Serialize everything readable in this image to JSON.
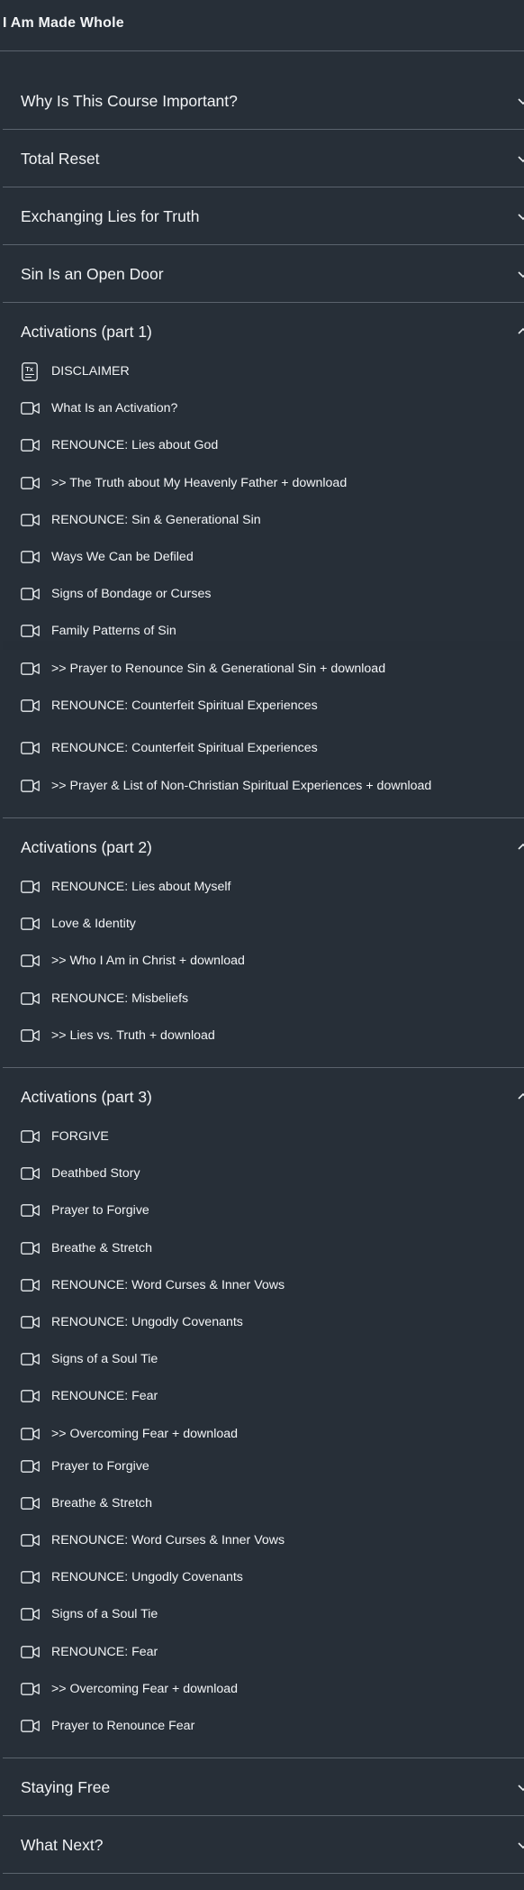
{
  "course": {
    "title": "I Am Made Whole"
  },
  "sections": [
    {
      "title": "Why Is This Course Important?",
      "expanded": false,
      "lessons": []
    },
    {
      "title": "Total Reset",
      "expanded": false,
      "lessons": []
    },
    {
      "title": "Exchanging Lies for Truth",
      "expanded": false,
      "lessons": []
    },
    {
      "title": "Sin Is an Open Door",
      "expanded": false,
      "lessons": []
    },
    {
      "title": "Activations (part 1)",
      "expanded": true,
      "lessons": [
        {
          "label": "DISCLAIMER",
          "icon": "document-text-icon"
        },
        {
          "label": "What Is an Activation?",
          "icon": "video-camera-icon"
        },
        {
          "label": "RENOUNCE: Lies about God",
          "icon": "video-camera-icon"
        },
        {
          "label": ">> The Truth about My Heavenly Father + download",
          "icon": "video-camera-icon"
        },
        {
          "label": "RENOUNCE: Sin & Generational Sin",
          "icon": "video-camera-icon"
        },
        {
          "label": "Ways We Can be Defiled",
          "icon": "video-camera-icon"
        },
        {
          "label": "Signs of Bondage or Curses",
          "icon": "video-camera-icon"
        },
        {
          "label": "Family Patterns of Sin",
          "icon": "video-camera-icon"
        },
        {
          "label": ">> Prayer to Renounce Sin & Generational Sin + download",
          "icon": "video-camera-icon"
        },
        {
          "label": "RENOUNCE: Counterfeit Spiritual Experiences",
          "icon": "video-camera-icon"
        },
        {
          "label": "RENOUNCE: Counterfeit Spiritual Experiences",
          "icon": "video-camera-icon"
        },
        {
          "label": ">> Prayer & List of Non-Christian Spiritual Experiences + download",
          "icon": "video-camera-icon"
        }
      ]
    },
    {
      "title": "Activations (part 2)",
      "expanded": true,
      "lessons": [
        {
          "label": "RENOUNCE: Lies about Myself",
          "icon": "video-camera-icon"
        },
        {
          "label": "Love & Identity",
          "icon": "video-camera-icon"
        },
        {
          "label": ">> Who I Am in Christ + download",
          "icon": "video-camera-icon"
        },
        {
          "label": "RENOUNCE: Misbeliefs",
          "icon": "video-camera-icon"
        },
        {
          "label": ">> Lies vs. Truth + download",
          "icon": "video-camera-icon"
        }
      ]
    },
    {
      "title": "Activations (part 3)",
      "expanded": true,
      "lessons": [
        {
          "label": "FORGIVE",
          "icon": "video-camera-icon"
        },
        {
          "label": "Deathbed Story",
          "icon": "video-camera-icon"
        },
        {
          "label": "Prayer to Forgive",
          "icon": "video-camera-icon"
        },
        {
          "label": "Breathe & Stretch",
          "icon": "video-camera-icon"
        },
        {
          "label": "RENOUNCE: Word Curses & Inner Vows",
          "icon": "video-camera-icon"
        },
        {
          "label": "RENOUNCE: Ungodly Covenants",
          "icon": "video-camera-icon"
        },
        {
          "label": "Signs of a Soul Tie",
          "icon": "video-camera-icon"
        },
        {
          "label": "RENOUNCE: Fear",
          "icon": "video-camera-icon"
        },
        {
          "label": ">> Overcoming Fear + download",
          "icon": "video-camera-icon"
        },
        {
          "label": "Prayer to Forgive",
          "icon": "video-camera-icon"
        },
        {
          "label": "Breathe & Stretch",
          "icon": "video-camera-icon"
        },
        {
          "label": "RENOUNCE: Word Curses & Inner Vows",
          "icon": "video-camera-icon"
        },
        {
          "label": "RENOUNCE: Ungodly Covenants",
          "icon": "video-camera-icon"
        },
        {
          "label": "Signs of a Soul Tie",
          "icon": "video-camera-icon"
        },
        {
          "label": "RENOUNCE: Fear",
          "icon": "video-camera-icon"
        },
        {
          "label": ">> Overcoming Fear + download",
          "icon": "video-camera-icon"
        },
        {
          "label": "Prayer to Renounce Fear",
          "icon": "video-camera-icon"
        }
      ]
    },
    {
      "title": "Staying Free",
      "expanded": false,
      "lessons": []
    },
    {
      "title": "What Next?",
      "expanded": false,
      "lessons": []
    }
  ]
}
